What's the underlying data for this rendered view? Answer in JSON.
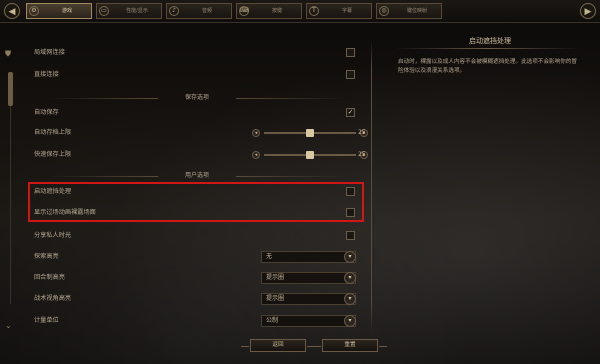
{
  "tabs": [
    {
      "label": "游戏",
      "icon": "gear-icon",
      "active": true
    },
    {
      "label": "性能/显示",
      "icon": "monitor-icon",
      "active": false
    },
    {
      "label": "音频",
      "icon": "speaker-icon",
      "active": false
    },
    {
      "label": "按键",
      "icon": "keyboard-icon",
      "active": false
    },
    {
      "label": "字幕",
      "icon": "text-icon",
      "active": false
    },
    {
      "label": "键位映射",
      "icon": "gamepad-icon",
      "active": false
    }
  ],
  "settings": {
    "lan_connect": {
      "label": "局域网连接",
      "checked": false
    },
    "direct_connect": {
      "label": "直接连接",
      "checked": false
    },
    "save_section": "保存选项",
    "autosave": {
      "label": "自动保存",
      "checked": true
    },
    "autosave_limit": {
      "label": "自动存档上限",
      "value": "25"
    },
    "quicksave_limit": {
      "label": "快速保存上限",
      "value": "25"
    },
    "user_section": "用户选项",
    "enable_occlusion": {
      "label": "启动遮挡处理",
      "checked": false
    },
    "show_cinematic_occlusion": {
      "label": "显示过场动画裸露场面",
      "checked": false
    },
    "share_private_time": {
      "label": "分享私人时光",
      "checked": false
    },
    "explore_highlight": {
      "label": "探索高亮",
      "value": "无"
    },
    "turn_highlight": {
      "label": "回合制高亮",
      "value": "提示圈"
    },
    "combat_view_highlight": {
      "label": "战术视角高亮",
      "value": "提示圈"
    },
    "units": {
      "label": "计量单位",
      "value": "公制"
    }
  },
  "description": {
    "title": "启动遮挡处理",
    "text": "启动时，裸露以及成人内容不会被模糊遮挡处理。此选项不会影响你的冒险体验以及浪漫关系选项。"
  },
  "buttons": {
    "back": "返回",
    "reset": "重置"
  },
  "colors": {
    "highlight_box": "#d11616",
    "accent_gold": "#a28a5e"
  }
}
